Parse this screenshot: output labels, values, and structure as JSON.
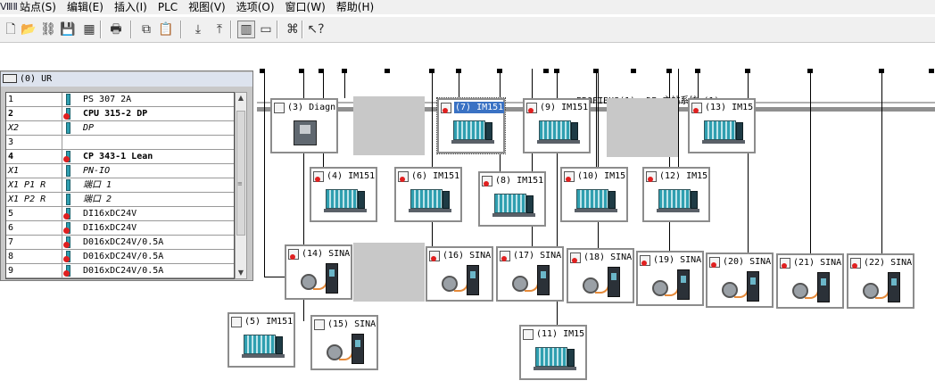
{
  "app": {
    "icon": "simatic-icon",
    "icon_glyph": "ⅧⅡ"
  },
  "menu": [
    {
      "id": "station",
      "label": "站点(S)"
    },
    {
      "id": "edit",
      "label": "编辑(E)"
    },
    {
      "id": "insert",
      "label": "插入(I)"
    },
    {
      "id": "plc",
      "label": "PLC"
    },
    {
      "id": "view",
      "label": "视图(V)"
    },
    {
      "id": "options",
      "label": "选项(O)"
    },
    {
      "id": "window",
      "label": "窗口(W)"
    },
    {
      "id": "help",
      "label": "帮助(H)"
    }
  ],
  "toolbar": [
    {
      "name": "new-icon",
      "glyph": "🗋"
    },
    {
      "name": "open-icon",
      "glyph": "📂"
    },
    {
      "name": "network-icon",
      "glyph": "⛓"
    },
    {
      "name": "save-icon",
      "glyph": "💾"
    },
    {
      "name": "compile-icon",
      "glyph": "▦"
    },
    {
      "name": "print-icon",
      "glyph": "🖶"
    },
    {
      "name": "copy-icon",
      "glyph": "⧉"
    },
    {
      "name": "paste-icon",
      "glyph": "📋"
    },
    {
      "name": "download-icon",
      "glyph": "⤓"
    },
    {
      "name": "upload-icon",
      "glyph": "⤒"
    },
    {
      "name": "catalog-icon",
      "glyph": "▥"
    },
    {
      "name": "properties-icon",
      "glyph": "▭"
    },
    {
      "name": "netpro-icon",
      "glyph": "⌘"
    },
    {
      "name": "help-icon",
      "glyph": "↖?"
    }
  ],
  "rack": {
    "title": "(0) UR",
    "rows": [
      {
        "slot": "1",
        "module": "PS 307 2A",
        "bold": false,
        "italic": false,
        "mod": true,
        "err": false
      },
      {
        "slot": "2",
        "module": "CPU 315-2 DP",
        "bold": true,
        "italic": false,
        "mod": true,
        "err": true
      },
      {
        "slot": "X2",
        "module": "DP",
        "bold": false,
        "italic": true,
        "mod": true,
        "err": false
      },
      {
        "slot": "3",
        "module": "",
        "bold": false,
        "italic": false,
        "mod": false,
        "err": false
      },
      {
        "slot": "4",
        "module": "CP 343-1 Lean",
        "bold": true,
        "italic": false,
        "mod": true,
        "err": true
      },
      {
        "slot": "X1",
        "module": "PN-IO",
        "bold": false,
        "italic": true,
        "mod": true,
        "err": false
      },
      {
        "slot": "X1 P1 R",
        "module": "端口 1",
        "bold": false,
        "italic": true,
        "mod": true,
        "err": false
      },
      {
        "slot": "X1 P2 R",
        "module": "端口 2",
        "bold": false,
        "italic": true,
        "mod": true,
        "err": false
      },
      {
        "slot": "5",
        "module": "DI16xDC24V",
        "bold": false,
        "italic": false,
        "mod": true,
        "err": true
      },
      {
        "slot": "6",
        "module": "DI16xDC24V",
        "bold": false,
        "italic": false,
        "mod": true,
        "err": true
      },
      {
        "slot": "7",
        "module": "D016xDC24V/0.5A",
        "bold": false,
        "italic": false,
        "mod": true,
        "err": true
      },
      {
        "slot": "8",
        "module": "D016xDC24V/0.5A",
        "bold": false,
        "italic": false,
        "mod": true,
        "err": true
      },
      {
        "slot": "9",
        "module": "D016xDC24V/0.5A",
        "bold": false,
        "italic": false,
        "mod": true,
        "err": true
      }
    ]
  },
  "bus": {
    "label": "PROFIBUS(1): DP 主站系统 (1)"
  },
  "devices": [
    {
      "id": "3",
      "label": "(3) Diagn",
      "kind": "diag",
      "selected": false,
      "highlight": false,
      "err": false
    },
    {
      "id": "7",
      "label": "(7) IM151",
      "kind": "im",
      "selected": true,
      "highlight": true,
      "err": true
    },
    {
      "id": "9",
      "label": "(9) IM151",
      "kind": "im",
      "selected": false,
      "highlight": false,
      "err": true
    },
    {
      "id": "13",
      "label": "(13) IM15",
      "kind": "im",
      "selected": false,
      "highlight": false,
      "err": true
    },
    {
      "id": "4",
      "label": "(4) IM151",
      "kind": "im",
      "selected": false,
      "highlight": false,
      "err": true
    },
    {
      "id": "6",
      "label": "(6) IM151",
      "kind": "im",
      "selected": false,
      "highlight": false,
      "err": true
    },
    {
      "id": "8",
      "label": "(8) IM151",
      "kind": "im",
      "selected": false,
      "highlight": false,
      "err": true
    },
    {
      "id": "10",
      "label": "(10) IM15",
      "kind": "im",
      "selected": false,
      "highlight": false,
      "err": true
    },
    {
      "id": "12",
      "label": "(12) IM15",
      "kind": "im",
      "selected": false,
      "highlight": false,
      "err": true
    },
    {
      "id": "14",
      "label": "(14) SINA",
      "kind": "sina",
      "selected": false,
      "highlight": false,
      "err": true
    },
    {
      "id": "16",
      "label": "(16) SINA",
      "kind": "sina",
      "selected": false,
      "highlight": false,
      "err": true
    },
    {
      "id": "17",
      "label": "(17) SINA",
      "kind": "sina",
      "selected": false,
      "highlight": false,
      "err": true
    },
    {
      "id": "18",
      "label": "(18) SINA",
      "kind": "sina",
      "selected": false,
      "highlight": false,
      "err": true
    },
    {
      "id": "19",
      "label": "(19) SINA",
      "kind": "sina",
      "selected": false,
      "highlight": false,
      "err": true
    },
    {
      "id": "20",
      "label": "(20) SINA",
      "kind": "sina",
      "selected": false,
      "highlight": false,
      "err": true
    },
    {
      "id": "21",
      "label": "(21) SINA",
      "kind": "sina",
      "selected": false,
      "highlight": false,
      "err": true
    },
    {
      "id": "22",
      "label": "(22) SINA",
      "kind": "sina",
      "selected": false,
      "highlight": false,
      "err": true
    },
    {
      "id": "5",
      "label": "(5) IM151",
      "kind": "im",
      "selected": false,
      "highlight": false,
      "err": false
    },
    {
      "id": "15",
      "label": "(15) SINA",
      "kind": "sina",
      "selected": false,
      "highlight": false,
      "err": false
    },
    {
      "id": "11",
      "label": "(11) IM15",
      "kind": "im",
      "selected": false,
      "highlight": false,
      "err": false
    }
  ],
  "colors": {
    "bus": "#909090",
    "selection": "#3a72c4",
    "error": "#e02020",
    "module": "#2f9fb0"
  }
}
